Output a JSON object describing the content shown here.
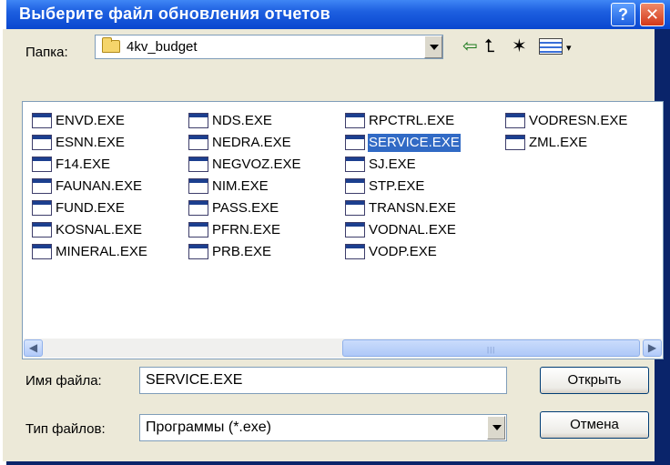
{
  "window": {
    "title": "Выберите файл обновления отчетов",
    "help_glyph": "?",
    "close_glyph": "✕"
  },
  "toolbar": {
    "folder_label": "Папка:",
    "folder_name": "4kv_budget",
    "back_glyph": "⇦",
    "up_glyph": "⮤",
    "new_folder_glyph": "✶",
    "view_arrow_glyph": "▾"
  },
  "files": {
    "col1": [
      "ENVD.EXE",
      "ESNN.EXE",
      "F14.EXE",
      "FAUNAN.EXE",
      "FUND.EXE",
      "KOSNAL.EXE",
      "MINERAL.EXE"
    ],
    "col2": [
      "NDS.EXE",
      "NEDRA.EXE",
      "NEGVOZ.EXE",
      "NIM.EXE",
      "PASS.EXE",
      "PFRN.EXE",
      "PRB.EXE"
    ],
    "col3": [
      "RPCTRL.EXE",
      "SERVICE.EXE",
      "SJ.EXE",
      "STP.EXE",
      "TRANSN.EXE",
      "VODNAL.EXE",
      "VODP.EXE"
    ],
    "col4": [
      "VODRESN.EXE",
      "ZML.EXE"
    ],
    "selected": "SERVICE.EXE"
  },
  "scroll": {
    "left_glyph": "◀",
    "right_glyph": "▶",
    "grip": "|||"
  },
  "form": {
    "filename_label": "Имя файла:",
    "filename_value": "SERVICE.EXE",
    "filetype_label": "Тип файлов:",
    "filetype_value": "Программы (*.exe)",
    "open_label": "Открыть",
    "cancel_label": "Отмена"
  }
}
